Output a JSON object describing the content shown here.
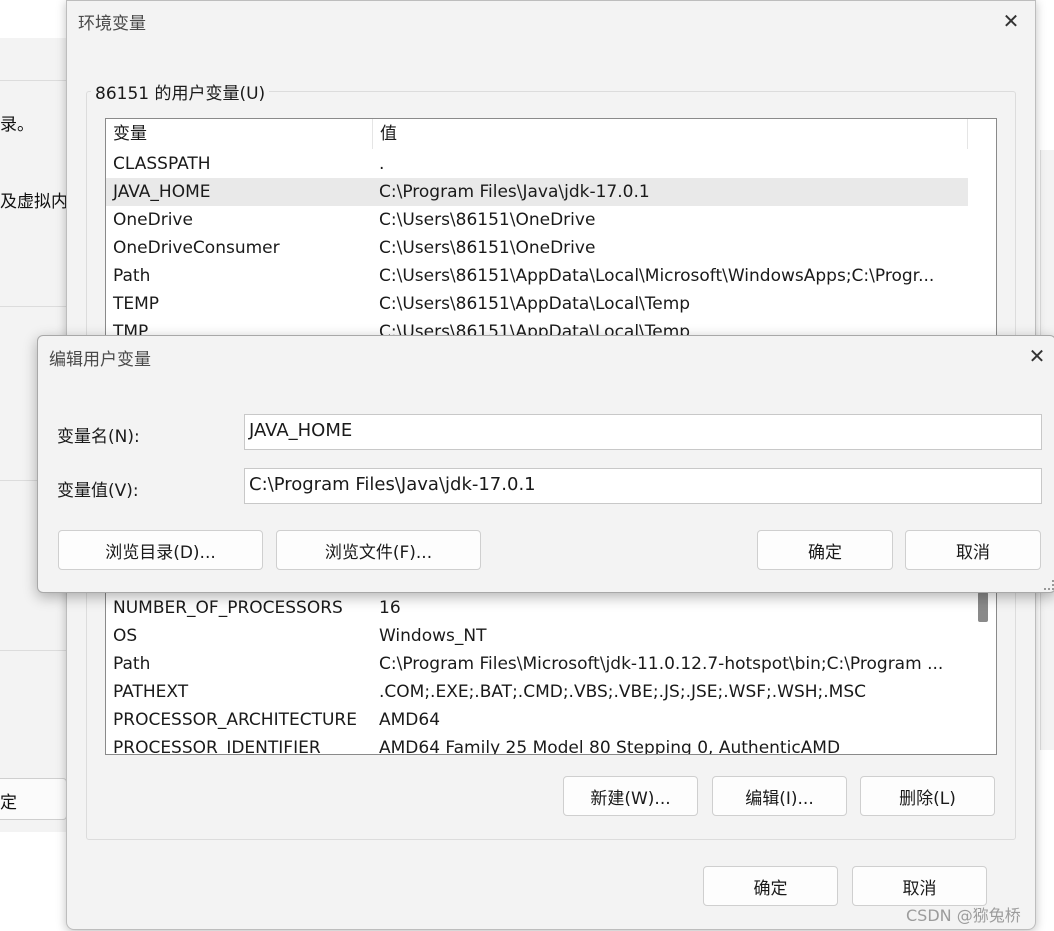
{
  "background_window": {
    "fragment_1": "录。",
    "fragment_2": "及虚拟内",
    "button_fragment": "定"
  },
  "env_dialog": {
    "title": "环境变量",
    "user_group_label": "86151 的用户变量(U)",
    "columns": [
      "变量",
      "值"
    ],
    "user_vars": [
      {
        "name": "CLASSPATH",
        "value": "."
      },
      {
        "name": "JAVA_HOME",
        "value": "C:\\Program Files\\Java\\jdk-17.0.1"
      },
      {
        "name": "OneDrive",
        "value": "C:\\Users\\86151\\OneDrive"
      },
      {
        "name": "OneDriveConsumer",
        "value": "C:\\Users\\86151\\OneDrive"
      },
      {
        "name": "Path",
        "value": "C:\\Users\\86151\\AppData\\Local\\Microsoft\\WindowsApps;C:\\Progr..."
      },
      {
        "name": "TEMP",
        "value": "C:\\Users\\86151\\AppData\\Local\\Temp"
      },
      {
        "name": "TMP",
        "value": "C:\\Users\\86151\\AppData\\Local\\Temp"
      }
    ],
    "system_vars": [
      {
        "name": "NUMBER_OF_PROCESSORS",
        "value": "16"
      },
      {
        "name": "OS",
        "value": "Windows_NT"
      },
      {
        "name": "Path",
        "value": "C:\\Program Files\\Microsoft\\jdk-11.0.12.7-hotspot\\bin;C:\\Program ..."
      },
      {
        "name": "PATHEXT",
        "value": ".COM;.EXE;.BAT;.CMD;.VBS;.VBE;.JS;.JSE;.WSF;.WSH;.MSC"
      },
      {
        "name": "PROCESSOR_ARCHITECTURE",
        "value": "AMD64"
      },
      {
        "name": "PROCESSOR_IDENTIFIER",
        "value": "AMD64 Family 25 Model 80 Stepping 0, AuthenticAMD"
      }
    ],
    "system_buttons": {
      "new": "新建(W)...",
      "edit": "编辑(I)...",
      "delete": "删除(L)"
    },
    "ok": "确定",
    "cancel": "取消"
  },
  "edit_dialog": {
    "title": "编辑用户变量",
    "name_label": "变量名(N):",
    "name_value": "JAVA_HOME",
    "value_label": "变量值(V):",
    "value_value": "C:\\Program Files\\Java\\jdk-17.0.1",
    "browse_dir": "浏览目录(D)...",
    "browse_file": "浏览文件(F)...",
    "ok": "确定",
    "cancel": "取消"
  },
  "watermark": "CSDN @猕兔桥"
}
